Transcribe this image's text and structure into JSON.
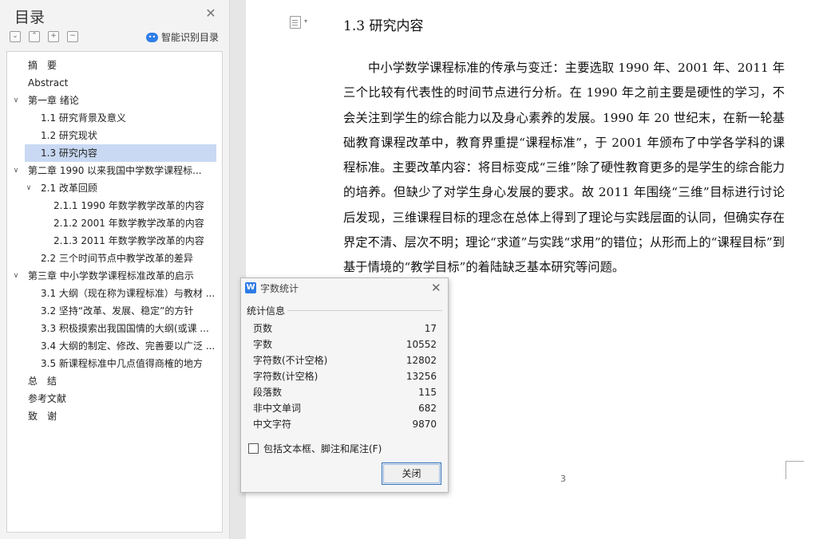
{
  "sidebar": {
    "title": "目录",
    "close_icon": "close-icon",
    "tools": [
      "expand-all-icon",
      "collapse-all-icon",
      "add-icon",
      "remove-icon"
    ],
    "smart_toc_label": "智能识别目录",
    "items": [
      {
        "label": "摘　要",
        "level": 0,
        "caret": ""
      },
      {
        "label": "Abstract",
        "level": 0,
        "caret": ""
      },
      {
        "label": "第一章 绪论",
        "level": 0,
        "caret": "v"
      },
      {
        "label": "1.1 研究背景及意义",
        "level": 1,
        "caret": ""
      },
      {
        "label": "1.2 研究现状",
        "level": 1,
        "caret": ""
      },
      {
        "label": "1.3 研究内容",
        "level": 1,
        "caret": "",
        "active": true
      },
      {
        "label": "第二章 1990 以来我国中学数学课程标...",
        "level": 0,
        "caret": "v"
      },
      {
        "label": "2.1 改革回顾",
        "level": 1,
        "caret": "v"
      },
      {
        "label": "2.1.1 1990 年数学教学改革的内容",
        "level": 2,
        "caret": ""
      },
      {
        "label": "2.1.2 2001 年数学教学改革的内容",
        "level": 2,
        "caret": ""
      },
      {
        "label": "2.1.3 2011 年数学教学改革的内容",
        "level": 2,
        "caret": ""
      },
      {
        "label": "2.2 三个时间节点中教学改革的差异",
        "level": 1,
        "caret": ""
      },
      {
        "label": "第三章 中小学数学课程标准改革的启示",
        "level": 0,
        "caret": "v"
      },
      {
        "label": "3.1 大纲（现在称为课程标准）与教材 ...",
        "level": 1,
        "caret": ""
      },
      {
        "label": "3.2 坚持“改革、发展、稳定”的方针",
        "level": 1,
        "caret": ""
      },
      {
        "label": "3.3 积极摸索出我国国情的大纲(或课 ...",
        "level": 1,
        "caret": ""
      },
      {
        "label": "3.4 大纲的制定、修改、完善要以广泛 ...",
        "level": 1,
        "caret": ""
      },
      {
        "label": "3.5 新课程标准中几点值得商榷的地方",
        "level": 1,
        "caret": ""
      },
      {
        "label": "总　结",
        "level": 0,
        "caret": ""
      },
      {
        "label": "参考文献",
        "level": 0,
        "caret": ""
      },
      {
        "label": "致　谢",
        "level": 0,
        "caret": ""
      }
    ]
  },
  "document": {
    "heading": "1.3 研究内容",
    "paragraph": "中小学数学课程标准的传承与变迁：主要选取 1990 年、2001 年、2011 年三个比较有代表性的时间节点进行分析。在 1990 年之前主要是硬性的学习，不会关注到学生的综合能力以及身心素养的发展。1990 年 20 世纪末，在新一轮基础教育课程改革中，教育界重提“课程标准”，于 2001 年颁布了中学各学科的课程标准。主要改革内容：将目标变成“三维”除了硬性教育更多的是学生的综合能力的培养。但缺少了对学生身心发展的要求。故 2011 年围绕“三维”目标进行讨论后发现，三维课程目标的理念在总体上得到了理论与实践层面的认同，但确实存在界定不清、层次不明；理论“求道”与实践“求用”的错位；从形而上的“课程目标”到基于情境的“教学目标”的着陆缺乏基本研究等问题。",
    "page_number": "3"
  },
  "dialog": {
    "title": "字数统计",
    "section": "统计信息",
    "stats": [
      {
        "label": "页数",
        "value": "17"
      },
      {
        "label": "字数",
        "value": "10552"
      },
      {
        "label": "字符数(不计空格)",
        "value": "12802"
      },
      {
        "label": "字符数(计空格)",
        "value": "13256"
      },
      {
        "label": "段落数",
        "value": "115"
      },
      {
        "label": "非中文单词",
        "value": "682"
      },
      {
        "label": "中文字符",
        "value": "9870"
      }
    ],
    "checkbox_label": "包括文本框、脚注和尾注(F)",
    "checkbox_checked": false,
    "close_label": "关闭"
  }
}
